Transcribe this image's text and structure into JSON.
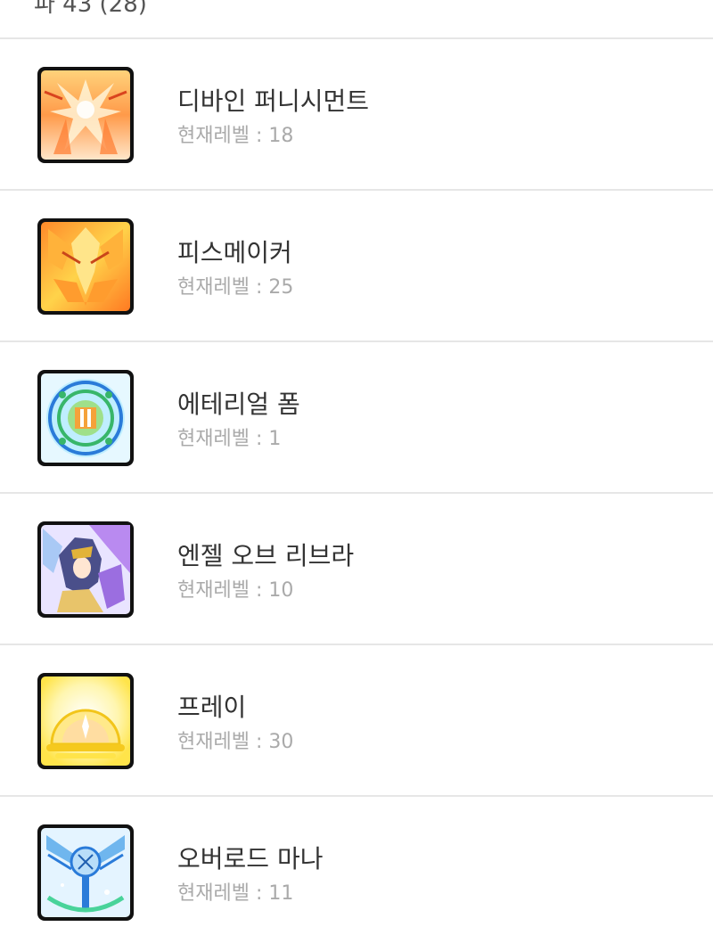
{
  "header": {
    "title": "파 43 (28)"
  },
  "level_prefix": "현재레벨 : ",
  "skills": [
    {
      "name": "디바인 퍼니시먼트",
      "level": "18",
      "icon": "divine-punishment-icon"
    },
    {
      "name": "피스메이커",
      "level": "25",
      "icon": "peacemaker-icon"
    },
    {
      "name": "에테리얼 폼",
      "level": "1",
      "icon": "ethereal-form-icon"
    },
    {
      "name": "엔젤 오브 리브라",
      "level": "10",
      "icon": "angel-of-libra-icon"
    },
    {
      "name": "프레이",
      "level": "30",
      "icon": "pray-icon"
    },
    {
      "name": "오버로드 마나",
      "level": "11",
      "icon": "overload-mana-icon"
    }
  ],
  "colors": {
    "divider": "#e6e6e6",
    "name_text": "#333333",
    "level_text": "#aaaaaa"
  }
}
